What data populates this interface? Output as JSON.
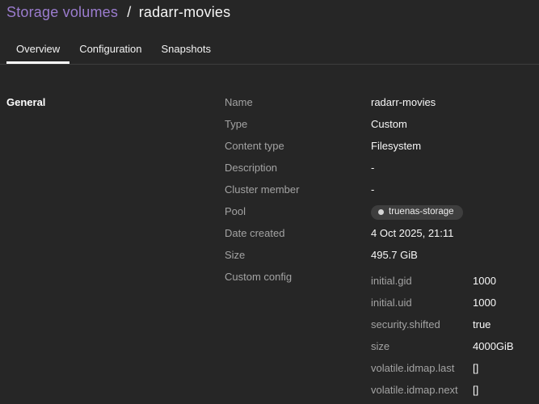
{
  "breadcrumb": {
    "parent": "Storage volumes",
    "separator": "/",
    "current": "radarr-movies"
  },
  "tabs": [
    {
      "label": "Overview"
    },
    {
      "label": "Configuration"
    },
    {
      "label": "Snapshots"
    }
  ],
  "section": {
    "heading": "General"
  },
  "rows": [
    {
      "label": "Name",
      "value": "radarr-movies"
    },
    {
      "label": "Type",
      "value": "Custom"
    },
    {
      "label": "Content type",
      "value": "Filesystem"
    },
    {
      "label": "Description",
      "value": "-"
    },
    {
      "label": "Cluster member",
      "value": "-"
    },
    {
      "label": "Pool",
      "value": "truenas-storage"
    },
    {
      "label": "Date created",
      "value": "4 Oct 2025, 21:11"
    },
    {
      "label": "Size",
      "value": "495.7 GiB"
    },
    {
      "label": "Custom config"
    }
  ],
  "custom_config": [
    {
      "key": "initial.gid",
      "value": "1000"
    },
    {
      "key": "initial.uid",
      "value": "1000"
    },
    {
      "key": "security.shifted",
      "value": "true"
    },
    {
      "key": "size",
      "value": "4000GiB"
    },
    {
      "key": "volatile.idmap.last",
      "value": "[]"
    },
    {
      "key": "volatile.idmap.next",
      "value": "[]"
    }
  ],
  "colors": {
    "background": "#262626",
    "link_purple": "#9b7cce",
    "label_gray": "#a3a3a3",
    "value_white": "#f7f7f7",
    "divider": "#3d3d3d",
    "badge_bg": "#3e3e3e",
    "active_tab_underline": "#ffffff"
  }
}
